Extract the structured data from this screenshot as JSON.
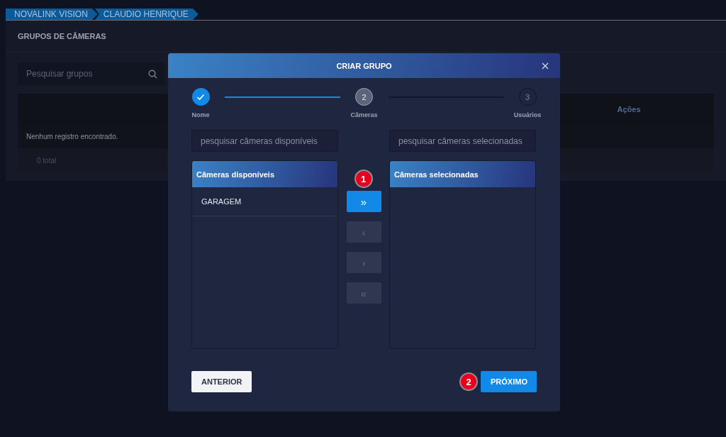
{
  "breadcrumb": [
    {
      "label": "NOVALINK VISION"
    },
    {
      "label": "CLAUDIO HENRIQUE"
    }
  ],
  "page": {
    "title": "GRUPOS DE CÂMERAS",
    "search": {
      "placeholder": "Pesquisar grupos"
    },
    "table": {
      "columns": [
        "Ações"
      ],
      "empty_message": "Nenhum registro encontrado.",
      "footer": "0 total"
    }
  },
  "dialog": {
    "title": "CRIAR GRUPO",
    "steps": [
      {
        "label": "Nome",
        "done": true,
        "current": false
      },
      {
        "number": "2",
        "label": "Câmeras",
        "done": false,
        "current": true
      },
      {
        "number": "3",
        "label": "Usuários",
        "done": false,
        "current": false
      }
    ],
    "available": {
      "search_placeholder": "pesquisar câmeras disponíveis",
      "title": "Câmeras disponíveis",
      "items": [
        {
          "label": "GARAGEM",
          "selected": false
        }
      ]
    },
    "transfer_buttons": [
      {
        "symbol": "»",
        "disabled": false,
        "badge": "1"
      },
      {
        "symbol": "‹",
        "disabled": true
      },
      {
        "symbol": "›",
        "disabled": true
      },
      {
        "symbol": "«",
        "disabled": true
      }
    ],
    "chosen": {
      "search_placeholder": "pesquisar câmeras selecionadas",
      "title": "Câmeras selecionadas"
    },
    "buttons": [
      {
        "label": "ANTERIOR",
        "kind": "secondary"
      },
      {
        "label": "PRÓXIMO",
        "kind": "primary",
        "badge": "2"
      }
    ]
  }
}
